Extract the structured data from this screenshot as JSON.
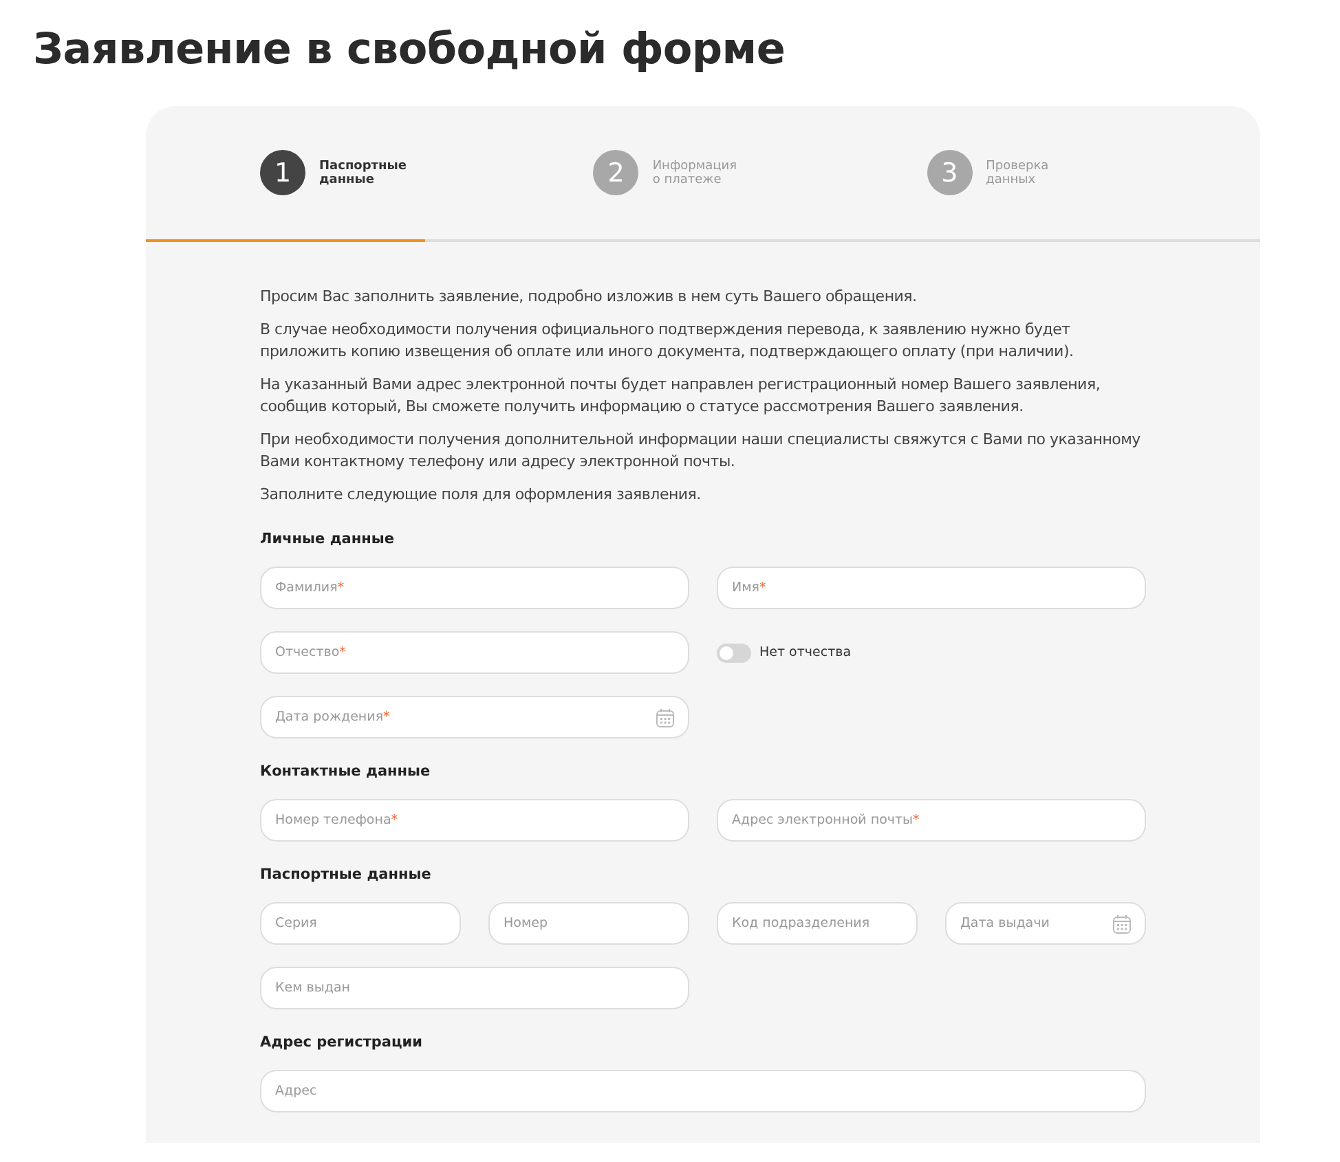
{
  "title": "Заявление в свободной форме",
  "steps": [
    {
      "number": "1",
      "label": "Паспортные данные",
      "selected": true
    },
    {
      "number": "2",
      "label": "Информация о платеже",
      "selected": false
    },
    {
      "number": "3",
      "label": "Проверка данных",
      "selected": false
    }
  ],
  "progress": {
    "level": 0.25
  },
  "intro": [
    "Просим Вас заполнить заявление, подробно изложив в нем суть Вашего обращения.",
    "В случае необходимости получения официального подтверждения перевода, к заявлению нужно будет приложить копию извещения об оплате или иного документа, подтверждающего оплату (при наличии).",
    "На указанный Вами адрес электронной почты будет направлен регистрационный номер Вашего заявления, сообщив который, Вы сможете получить информацию о статусе рассмотрения Вашего заявления.",
    "При необходимости получения дополнительной информации наши специалисты свяжутся с Вами по указанному Вами контактному телефону или адресу электронной почты.",
    "Заполните следующие поля для оформления заявления."
  ],
  "sections": [
    {
      "title": "Личные данные",
      "rows": [
        [
          {
            "kind": "field",
            "placeholder": "Фамилия",
            "required": "*"
          },
          {
            "kind": "field",
            "placeholder": "Имя",
            "required": "*"
          }
        ],
        [
          {
            "kind": "field",
            "placeholder": "Отчество",
            "required": "*"
          },
          {
            "kind": "toggle",
            "label": "Нет отчества",
            "on": false
          }
        ],
        [
          {
            "kind": "date",
            "placeholder": "Дата рождения",
            "required": "*"
          }
        ]
      ]
    },
    {
      "title": "Контактные данные",
      "rows": [
        [
          {
            "kind": "field",
            "placeholder": "Номер телефона",
            "required": "*"
          },
          {
            "kind": "field",
            "placeholder": "Адрес электронной почты",
            "required": "*"
          }
        ]
      ]
    },
    {
      "title": "Паспортные данные",
      "rows": [
        [
          {
            "kind": "field",
            "placeholder": "Серия"
          },
          {
            "kind": "field",
            "placeholder": "Номер"
          },
          {
            "kind": "field",
            "placeholder": "Код подразделения"
          },
          {
            "kind": "date",
            "placeholder": "Дата выдачи"
          }
        ],
        [
          {
            "kind": "field",
            "placeholder": "Кем выдан"
          }
        ]
      ]
    },
    {
      "title": "Адрес регистрации",
      "kind": "wide",
      "rows": [
        [
          {
            "kind": "field",
            "placeholder": "Адрес"
          }
        ]
      ]
    }
  ]
}
